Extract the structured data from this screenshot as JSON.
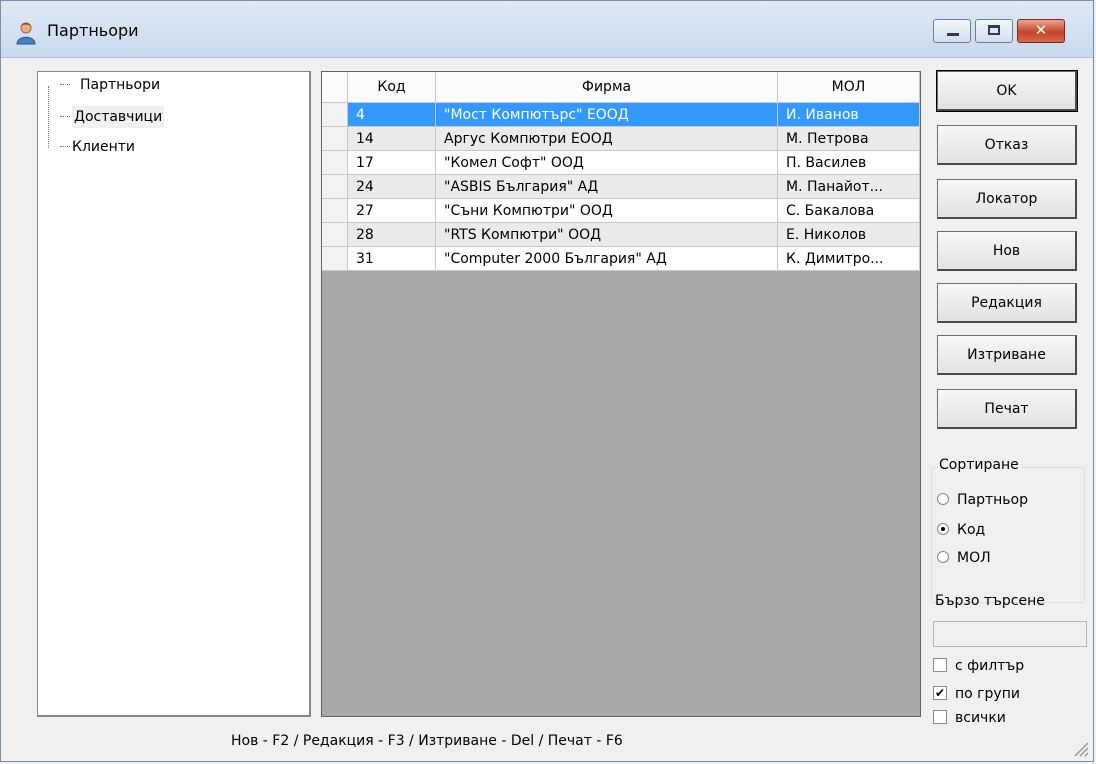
{
  "window": {
    "title": "Партньори",
    "controls": {
      "minimize": "minimize",
      "maximize": "maximize",
      "close": "✕"
    }
  },
  "tree": {
    "items": [
      {
        "label": "Партньори"
      },
      {
        "label": "Доставчици"
      },
      {
        "label": "Клиенти"
      }
    ]
  },
  "table": {
    "columns": [
      "Код",
      "Фирма",
      "МОЛ"
    ],
    "rows": [
      {
        "code": "4",
        "firm": "\"Мост Компютърс\" ЕООД",
        "mol": "И. Иванов"
      },
      {
        "code": "14",
        "firm": "Аргус Компютри ЕООД",
        "mol": "М. Петрова"
      },
      {
        "code": "17",
        "firm": "\"Комел Софт\" ООД",
        "mol": "П. Василев"
      },
      {
        "code": "24",
        "firm": "\"ASBIS България\" АД",
        "mol": "М. Панайот..."
      },
      {
        "code": "27",
        "firm": "\"Съни Компютри\" ООД",
        "mol": "С. Бакалова"
      },
      {
        "code": "28",
        "firm": "\"RTS Компютри\" ООД",
        "mol": "Е. Николов"
      },
      {
        "code": "31",
        "firm": "\"Computer 2000 България\" АД",
        "mol": "К. Димитро..."
      }
    ],
    "selected_row": 0
  },
  "buttons": {
    "ok": "OK",
    "cancel": "Отказ",
    "locator": "Локатор",
    "new": "Нов",
    "edit": "Редакция",
    "delete": "Изтриване",
    "print": "Печат"
  },
  "sort": {
    "title": "Сортиране",
    "options": [
      "Партньор",
      "Код",
      "МОЛ"
    ],
    "selected": "Код"
  },
  "quick_search": {
    "label": "Бързо търсене",
    "value": ""
  },
  "options": {
    "with_filter": {
      "label": "с филтър",
      "checked": false
    },
    "by_groups": {
      "label": "по групи",
      "checked": true
    },
    "all": {
      "label": "всички",
      "checked": false
    }
  },
  "status_bar": "Нов - F2 / Редакция - F3 / Изтриване - Del / Печат - F6",
  "colors": {
    "selection": "#3399ff",
    "grid_background": "#a9a9a9",
    "close_button": "#c7432a"
  }
}
